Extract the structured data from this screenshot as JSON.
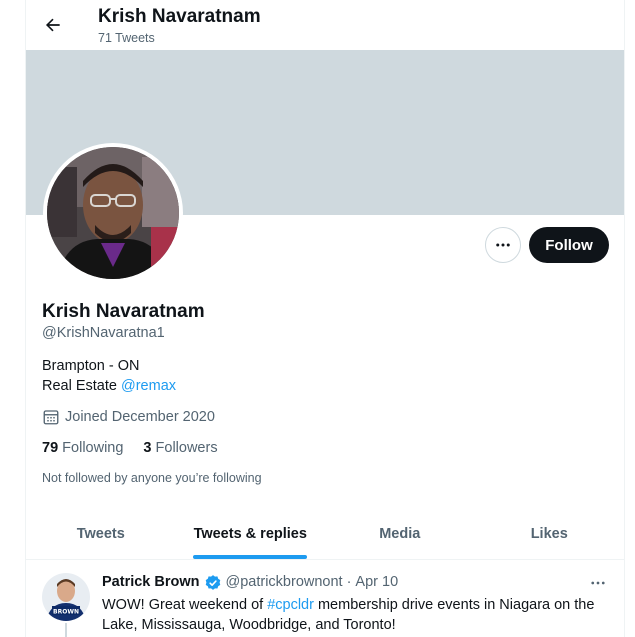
{
  "header": {
    "name": "Krish Navaratnam",
    "tweet_count": "71 Tweets"
  },
  "profile": {
    "name": "Krish Navaratnam",
    "handle": "@KrishNavaratna1",
    "bio_line1": "Brampton - ON",
    "bio_line2_prefix": "Real Estate ",
    "bio_link": "@remax",
    "joined": "Joined December 2020",
    "following_count": "79",
    "following_label": "Following",
    "followers_count": "3",
    "followers_label": "Followers",
    "not_followed": "Not followed by anyone you’re following"
  },
  "actions": {
    "follow_label": "Follow"
  },
  "tabs": [
    {
      "label": "Tweets",
      "active": false
    },
    {
      "label": "Tweets & replies",
      "active": true
    },
    {
      "label": "Media",
      "active": false
    },
    {
      "label": "Likes",
      "active": false
    }
  ],
  "tweet": {
    "author": "Patrick Brown",
    "handle": "@patrickbrownont",
    "separator": "·",
    "date": "Apr 10",
    "text_prefix": "WOW! Great weekend of ",
    "hashtag": "#cpcldr",
    "text_suffix": " membership drive events in Niagara on the Lake, Mississauga, Woodbridge, and Toronto!",
    "avatar_text": "BROWN"
  },
  "colors": {
    "accent": "#1d9bf0",
    "banner": "#cfd9de",
    "follow_button": "#0f1419"
  }
}
